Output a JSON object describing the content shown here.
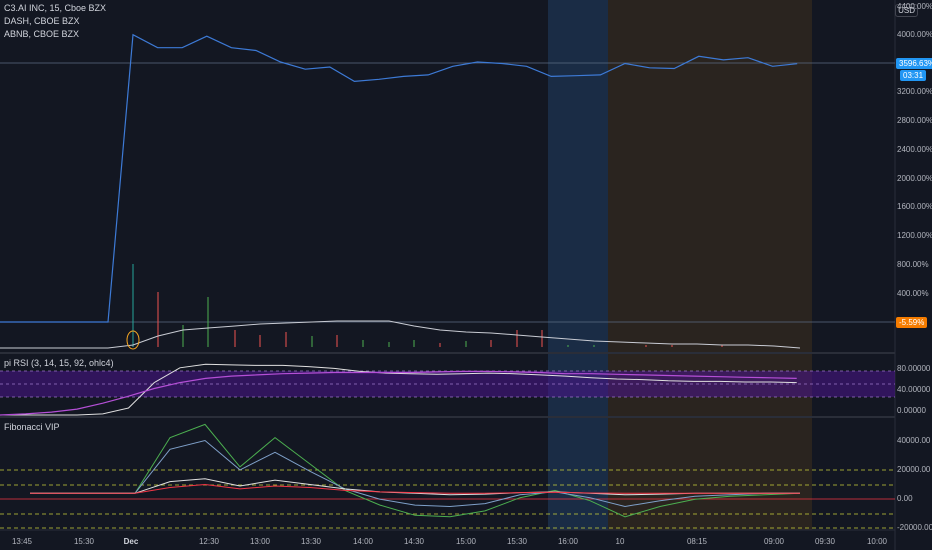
{
  "legend": {
    "main": "C3.AI INC, 15, Cboe BZX",
    "compare1": "DASH, CBOE BZX",
    "compare2": "ABNB, CBOE BZX"
  },
  "currency": "USD",
  "price_tag": {
    "value": "3596.63%",
    "countdown": "03:31"
  },
  "compare_tag": "-5.59%",
  "main_axis": [
    "4400.00%",
    "4000.00%",
    "3600.00%",
    "3200.00%",
    "2800.00%",
    "2400.00%",
    "2000.00%",
    "1600.00%",
    "1200.00%",
    "800.00%",
    "400.00%"
  ],
  "rsi": {
    "title": "pi RSI (3, 14, 15, 92, ohlc4)",
    "axis": [
      "80.00000",
      "40.00000",
      "0.00000"
    ]
  },
  "fib": {
    "title": "Fibonacci VIP",
    "axis": [
      "40000.00",
      "20000.00",
      "0.00",
      "-20000.00"
    ]
  },
  "time_axis": [
    "13:45",
    "15:30",
    "Dec",
    "12:30",
    "13:00",
    "13:30",
    "14:00",
    "14:30",
    "15:00",
    "15:30",
    "16:00",
    "10",
    "08:15",
    "09:00",
    "09:30",
    "10:00"
  ],
  "colors": {
    "main_line": "#3d7ad6",
    "price_tag": "#2196f3",
    "compare_tag": "#f57c00",
    "rsi_band": "#6a1b9a",
    "session_blue": "#1c3a5e",
    "session_orange": "#3b2f25"
  },
  "chart_data": [
    {
      "type": "line",
      "title": "C3.AI INC, 15, Cboe BZX",
      "ylabel": "",
      "ylim": [
        0,
        4400
      ],
      "series": [
        {
          "name": "C3.AI INC",
          "values": [
            0,
            0,
            0,
            0,
            0,
            0,
            0,
            4000,
            3820,
            3820,
            3980,
            3820,
            3780,
            3620,
            3520,
            3550,
            3350,
            3380,
            3420,
            3440,
            3560,
            3620,
            3600,
            3560,
            3420,
            3430,
            3440,
            3600,
            3540,
            3530,
            3700,
            3650,
            3680,
            3560,
            3596
          ]
        }
      ]
    },
    {
      "type": "line",
      "title": "pi RSI (3, 14, 15, 92, ohlc4)",
      "ylim": [
        -5,
        100
      ],
      "series": [
        {
          "name": "",
          "values": [
            0,
            0,
            0,
            0,
            2,
            12,
            55,
            80,
            86,
            85,
            84,
            84,
            82,
            79,
            74,
            71,
            70,
            69,
            70,
            71,
            70,
            68,
            66,
            63,
            61,
            60,
            58,
            57,
            57,
            56,
            56,
            55
          ]
        },
        {
          "name": "",
          "values": [
            0,
            2,
            5,
            10,
            20,
            32,
            45,
            55,
            62,
            66,
            68,
            70,
            71,
            72,
            72,
            72,
            72,
            73,
            74,
            74,
            73,
            72,
            70,
            70,
            69,
            68,
            67,
            66,
            65,
            64,
            63,
            62
          ]
        }
      ]
    },
    {
      "type": "line",
      "title": "Fibonacci VIP",
      "ylim": [
        -25000,
        50000
      ],
      "series": [
        {
          "name": "",
          "values": [
            0,
            0,
            0,
            0,
            38000,
            47000,
            18000,
            38000,
            20000,
            2000,
            -8000,
            -15000,
            -16000,
            -12000,
            -3000,
            2000,
            -5000,
            -16000,
            -9000,
            -4000,
            -2000,
            -1000,
            0
          ]
        },
        {
          "name": "",
          "values": [
            0,
            0,
            0,
            0,
            30000,
            36000,
            16000,
            28000,
            15000,
            3000,
            -4000,
            -8000,
            -9000,
            -7000,
            -1000,
            1000,
            -3000,
            -9000,
            -5000,
            -2000,
            -1000,
            0,
            0
          ]
        },
        {
          "name": "",
          "values": [
            0,
            0,
            0,
            0,
            8000,
            10000,
            5000,
            9000,
            6000,
            3000,
            1000,
            0,
            -1000,
            -500,
            500,
            1000,
            0,
            -1000,
            -500,
            0,
            0,
            0,
            0
          ]
        },
        {
          "name": "",
          "values": [
            0,
            0,
            0,
            0,
            4000,
            6000,
            3000,
            5000,
            4000,
            2000,
            1000,
            500,
            0,
            0,
            500,
            800,
            200,
            0,
            0,
            0,
            0,
            0,
            0
          ]
        }
      ]
    }
  ]
}
